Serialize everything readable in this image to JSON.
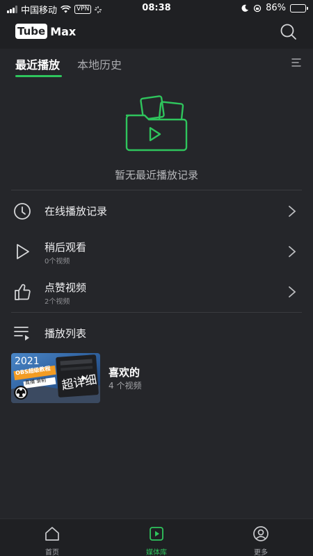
{
  "status_bar": {
    "carrier": "中国移动",
    "vpn": "VPN",
    "time": "08:38",
    "battery": "86%",
    "battery_level": 0.86
  },
  "app": {
    "logo_tube": "Tube",
    "logo_max": "Max"
  },
  "tabs": [
    {
      "label": "最近播放",
      "active": true
    },
    {
      "label": "本地历史",
      "active": false
    }
  ],
  "empty_state": {
    "message": "暂无最近播放记录",
    "icon": "folder-play-icon"
  },
  "library": {
    "items": [
      {
        "icon": "clock-icon",
        "title": "在线播放记录",
        "subtitle": ""
      },
      {
        "icon": "play-outline-icon",
        "title": "稍后观看",
        "subtitle": "0个视频"
      },
      {
        "icon": "thumbs-up-icon",
        "title": "点赞视频",
        "subtitle": "2个视频"
      }
    ],
    "playlists_label": "播放列表"
  },
  "playlist": {
    "title": "喜欢的",
    "count": "4 个视频",
    "thumbnail_text_year": "2021",
    "thumbnail_text_obs": "OBS超级教程",
    "thumbnail_text_big": "超详细",
    "thumbnail_text_small": "直播 录制"
  },
  "bottom_nav": [
    {
      "label": "首页",
      "icon": "home-icon",
      "active": false
    },
    {
      "label": "媒体库",
      "icon": "library-play-icon",
      "active": true
    },
    {
      "label": "更多",
      "icon": "account-circle-icon",
      "active": false
    }
  ],
  "colors": {
    "background": "#25262a",
    "bar": "#1f2023",
    "accent": "#2fc55d"
  }
}
